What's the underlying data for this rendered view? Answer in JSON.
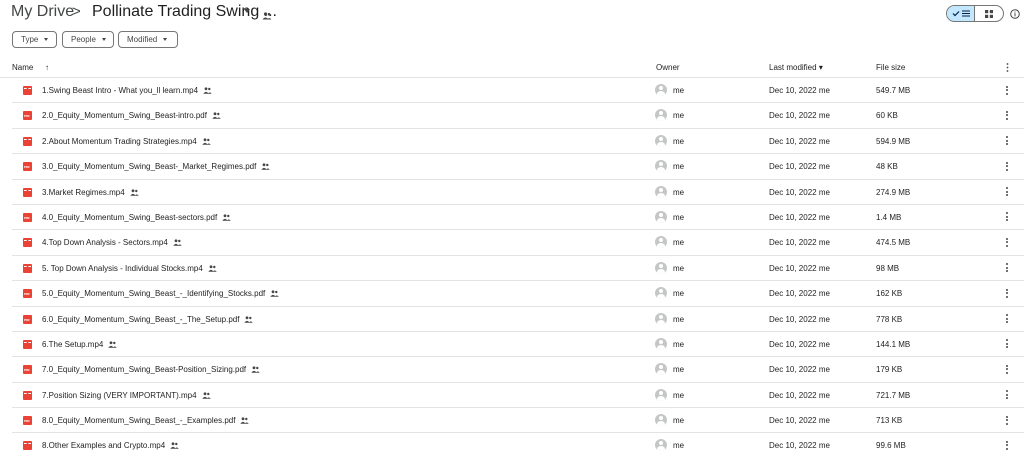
{
  "breadcrumb": {
    "root": "My Drive",
    "separator": ">",
    "current": "Pollinate Trading Swing ..."
  },
  "icons": {
    "shared": "people-icon",
    "info": "info-icon",
    "list_view": "check-list-icon",
    "grid_view": "grid-icon",
    "more": "more-vert-icon",
    "sort": "arrow-up-icon"
  },
  "colors": {
    "accent": "#c2e7ff",
    "file_icon": "#ea4335"
  },
  "filters": {
    "type": "Type",
    "people": "People",
    "modified": "Modified"
  },
  "columns": {
    "name": "Name",
    "sort_arrow": "↑",
    "owner": "Owner",
    "last_modified": "Last modified",
    "sort_caret": "▾",
    "file_size": "File size"
  },
  "files": [
    {
      "name": "1.Swing Beast Intro - What you_ll learn.mp4",
      "kind": "video",
      "owner": "me",
      "modified": "Dec 10, 2022 me",
      "size": "549.7 MB"
    },
    {
      "name": "2.0_Equity_Momentum_Swing_Beast-intro.pdf",
      "kind": "pdf",
      "owner": "me",
      "modified": "Dec 10, 2022 me",
      "size": "60 KB"
    },
    {
      "name": "2.About Momentum Trading Strategies.mp4",
      "kind": "video",
      "owner": "me",
      "modified": "Dec 10, 2022 me",
      "size": "594.9 MB"
    },
    {
      "name": "3.0_Equity_Momentum_Swing_Beast-_Market_Regimes.pdf",
      "kind": "pdf",
      "owner": "me",
      "modified": "Dec 10, 2022 me",
      "size": "48 KB"
    },
    {
      "name": "3.Market Regimes.mp4",
      "kind": "video",
      "owner": "me",
      "modified": "Dec 10, 2022 me",
      "size": "274.9 MB"
    },
    {
      "name": "4.0_Equity_Momentum_Swing_Beast-sectors.pdf",
      "kind": "pdf",
      "owner": "me",
      "modified": "Dec 10, 2022 me",
      "size": "1.4 MB"
    },
    {
      "name": "4.Top Down Analysis - Sectors.mp4",
      "kind": "video",
      "owner": "me",
      "modified": "Dec 10, 2022 me",
      "size": "474.5 MB"
    },
    {
      "name": "5. Top Down Analysis - Individual Stocks.mp4",
      "kind": "video",
      "owner": "me",
      "modified": "Dec 10, 2022 me",
      "size": "98 MB"
    },
    {
      "name": "5.0_Equity_Momentum_Swing_Beast_-_Identifying_Stocks.pdf",
      "kind": "pdf",
      "owner": "me",
      "modified": "Dec 10, 2022 me",
      "size": "162 KB"
    },
    {
      "name": "6.0_Equity_Momentum_Swing_Beast_-_The_Setup.pdf",
      "kind": "pdf",
      "owner": "me",
      "modified": "Dec 10, 2022 me",
      "size": "778 KB"
    },
    {
      "name": "6.The Setup.mp4",
      "kind": "video",
      "owner": "me",
      "modified": "Dec 10, 2022 me",
      "size": "144.1 MB"
    },
    {
      "name": "7.0_Equity_Momentum_Swing_Beast-Position_Sizing.pdf",
      "kind": "pdf",
      "owner": "me",
      "modified": "Dec 10, 2022 me",
      "size": "179 KB"
    },
    {
      "name": "7.Position Sizing (VERY IMPORTANT).mp4",
      "kind": "video",
      "owner": "me",
      "modified": "Dec 10, 2022 me",
      "size": "721.7 MB"
    },
    {
      "name": "8.0_Equity_Momentum_Swing_Beast_-_Examples.pdf",
      "kind": "pdf",
      "owner": "me",
      "modified": "Dec 10, 2022 me",
      "size": "713 KB"
    },
    {
      "name": "8.Other Examples and Crypto.mp4",
      "kind": "video",
      "owner": "me",
      "modified": "Dec 10, 2022 me",
      "size": "99.6 MB"
    }
  ]
}
